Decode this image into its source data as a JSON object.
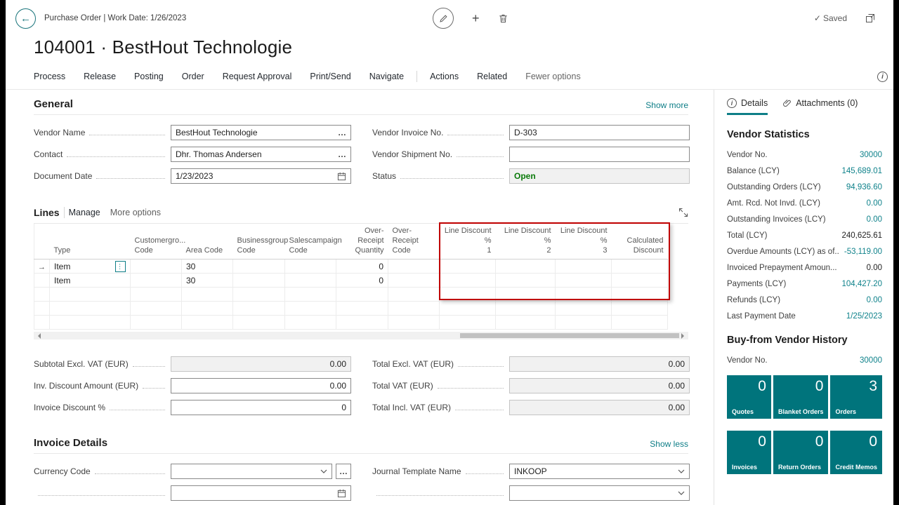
{
  "icons": {
    "back": "←",
    "plus": "+",
    "check": "✓",
    "ellipsis": "…",
    "row_arrow": "→",
    "info": "i"
  },
  "topbar": {
    "caption": "Purchase Order | Work Date: 1/26/2023",
    "saved_label": "Saved"
  },
  "page": {
    "title": "104001 · BestHout Technologie"
  },
  "ribbon": {
    "menu": [
      "Process",
      "Release",
      "Posting",
      "Order",
      "Request Approval",
      "Print/Send",
      "Navigate"
    ],
    "menu2": [
      "Actions",
      "Related"
    ],
    "fewer_options": "Fewer options"
  },
  "general": {
    "title": "General",
    "show_more": "Show more",
    "fields": {
      "vendor_name": {
        "label": "Vendor Name",
        "value": "BestHout Technologie"
      },
      "contact": {
        "label": "Contact",
        "value": "Dhr. Thomas Andersen"
      },
      "document_date": {
        "label": "Document Date",
        "value": "1/23/2023"
      },
      "vendor_invoice_no": {
        "label": "Vendor Invoice No.",
        "value": "D-303"
      },
      "vendor_shipment_no": {
        "label": "Vendor Shipment No.",
        "value": ""
      },
      "status": {
        "label": "Status",
        "value": "Open"
      }
    }
  },
  "lines": {
    "title": "Lines",
    "manage": "Manage",
    "more_options": "More options",
    "columns": [
      "Type",
      "Customergro...\nCode",
      "Area Code",
      "Businessgroup\nCode",
      "Salescampaign\nCode",
      "Over-Receipt\nQuantity",
      "Over-Receipt\nCode",
      "Line Discount %\n1",
      "Line Discount %\n2",
      "Line Discount %\n3",
      "Calculated\nDiscount"
    ],
    "rows": [
      {
        "type": "Item",
        "area_code": "30",
        "over_receipt_qty": "0"
      },
      {
        "type": "Item",
        "area_code": "30",
        "over_receipt_qty": "0"
      }
    ]
  },
  "totals": {
    "left": [
      {
        "label": "Subtotal Excl. VAT (EUR)",
        "value": "0.00"
      },
      {
        "label": "Inv. Discount Amount (EUR)",
        "value": "0.00"
      },
      {
        "label": "Invoice Discount %",
        "value": "0"
      }
    ],
    "right": [
      {
        "label": "Total Excl. VAT (EUR)",
        "value": "0.00"
      },
      {
        "label": "Total VAT (EUR)",
        "value": "0.00"
      },
      {
        "label": "Total Incl. VAT (EUR)",
        "value": "0.00"
      }
    ]
  },
  "invoice_details": {
    "title": "Invoice Details",
    "show_less": "Show less",
    "currency_code": {
      "label": "Currency Code",
      "value": ""
    },
    "journal_template": {
      "label": "Journal Template Name",
      "value": "INKOOP"
    }
  },
  "side": {
    "tabs": {
      "details": "Details",
      "attachments": "Attachments (0)"
    },
    "vendor_statistics": {
      "title": "Vendor Statistics",
      "rows": [
        {
          "label": "Vendor No.",
          "value": "30000"
        },
        {
          "label": "Balance (LCY)",
          "value": "145,689.01"
        },
        {
          "label": "Outstanding Orders (LCY)",
          "value": "94,936.60"
        },
        {
          "label": "Amt. Rcd. Not Invd. (LCY)",
          "value": "0.00"
        },
        {
          "label": "Outstanding Invoices (LCY)",
          "value": "0.00"
        },
        {
          "label": "Total (LCY)",
          "value": "240,625.61"
        },
        {
          "label": "Overdue Amounts (LCY) as of...",
          "value": "-53,119.00"
        },
        {
          "label": "Invoiced Prepayment Amoun...",
          "value": "0.00"
        },
        {
          "label": "Payments (LCY)",
          "value": "104,427.20"
        },
        {
          "label": "Refunds (LCY)",
          "value": "0.00"
        },
        {
          "label": "Last Payment Date",
          "value": "1/25/2023"
        }
      ]
    },
    "history": {
      "title": "Buy-from Vendor History",
      "vendor_no": {
        "label": "Vendor No.",
        "value": "30000"
      },
      "tiles": [
        {
          "label": "Quotes",
          "value": "0"
        },
        {
          "label": "Blanket Orders",
          "value": "0"
        },
        {
          "label": "Orders",
          "value": "3"
        },
        {
          "label": "Invoices",
          "value": "0"
        },
        {
          "label": "Return Orders",
          "value": "0"
        },
        {
          "label": "Credit Memos",
          "value": "0"
        }
      ]
    }
  },
  "colors": {
    "accent_teal": "#0E7E87",
    "tile_teal": "#00747C",
    "status_green": "#0A7A0A",
    "highlight_red": "#C00000"
  }
}
